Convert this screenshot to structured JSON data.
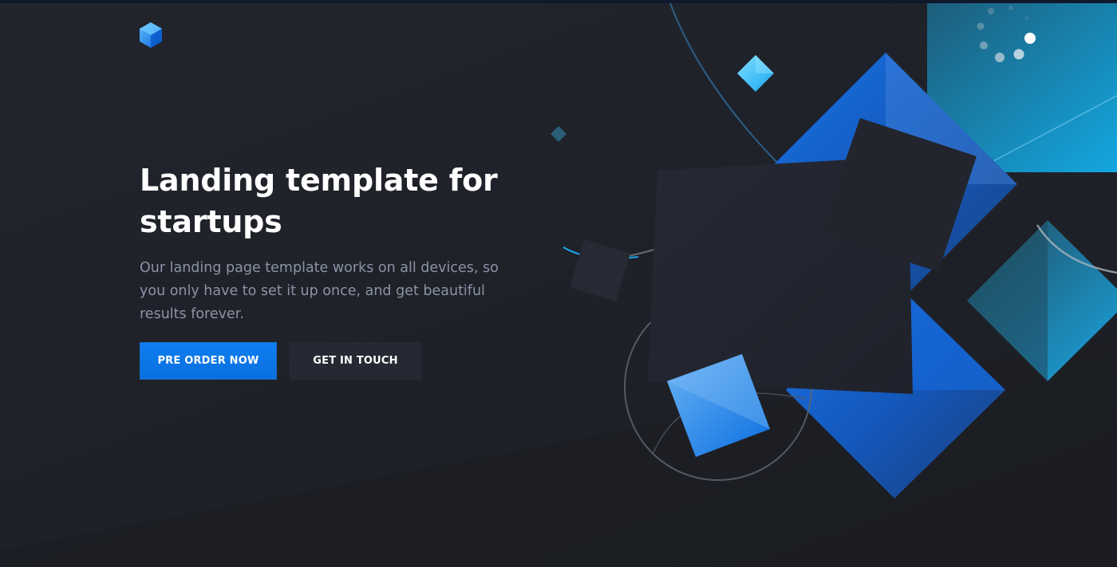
{
  "brand": {
    "logo_icon": "hexagon-cube-icon",
    "accent_color": "#0f7ef2"
  },
  "hero": {
    "title": "Landing template for startups",
    "text": "Our landing page template works on all devices, so you only have to set it up once, and get beautiful results forever."
  },
  "actions": {
    "primary_label": "PRE ORDER NOW",
    "secondary_label": "GET IN TOUCH"
  },
  "colors": {
    "background": "#1e2128",
    "primary_button": "#0f7ef2",
    "secondary_button": "#262933",
    "heading": "#ffffff",
    "body_text": "#8c93a6"
  }
}
